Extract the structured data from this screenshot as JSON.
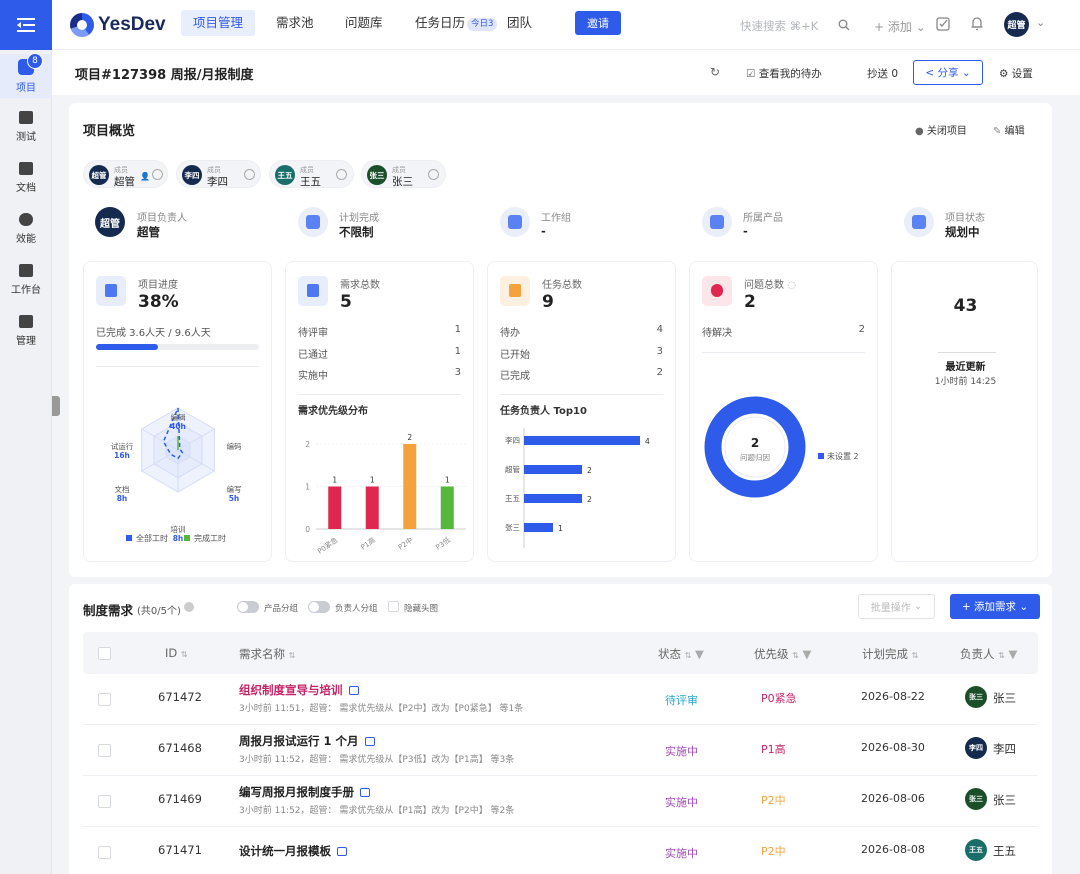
{
  "colors": {
    "accent": "#2f5bea",
    "red": "#e0274f",
    "orange": "#f5a23c",
    "green": "#55b83b",
    "pink": "#c52468",
    "purple": "#a04ab5"
  },
  "sidebar": {
    "badge": "8",
    "items": [
      {
        "label": "项目"
      },
      {
        "label": "测试"
      },
      {
        "label": "文档"
      },
      {
        "label": "效能"
      },
      {
        "label": "工作台"
      },
      {
        "label": "管理"
      }
    ]
  },
  "topnav": {
    "brand": "YesDev",
    "tabs": [
      "项目管理",
      "需求池",
      "问题库",
      "任务日历",
      "团队"
    ],
    "today_badge": "今日3",
    "invite": "邀请",
    "search_placeholder": "快速搜索 ⌘+K",
    "add": "+ 添加",
    "user_avatar": "超管"
  },
  "header": {
    "title": "项目#127398 周报/月报制度",
    "my_todo": "查看我的待办",
    "cc": "抄送 0",
    "share": "分享",
    "settings": "设置"
  },
  "overview": {
    "title": "项目概览",
    "close": "关闭项目",
    "edit": "编辑",
    "members": [
      {
        "avatar": "超管",
        "role": "成员",
        "name": "超管",
        "color": "#142a4f"
      },
      {
        "avatar": "李四",
        "role": "成员",
        "name": "李四",
        "color": "#142a4f"
      },
      {
        "avatar": "王五",
        "role": "成员",
        "name": "王五",
        "color": "#1a6e6a"
      },
      {
        "avatar": "张三",
        "role": "成员",
        "name": "张三",
        "color": "#1a4f2a"
      }
    ],
    "info": [
      {
        "label": "项目负责人",
        "value": "超管",
        "avatar": "超管"
      },
      {
        "label": "计划完成",
        "value": "不限制"
      },
      {
        "label": "工作组",
        "value": "-"
      },
      {
        "label": "所属产品",
        "value": "-"
      },
      {
        "label": "项目状态",
        "value": "规划中"
      }
    ],
    "progress": {
      "label": "项目进度",
      "value": "38%",
      "fraction": 0.38,
      "detail": "已完成 3.6人天 / 9.6人天"
    },
    "radar": {
      "axes": [
        {
          "name": "编辑",
          "value": "40h"
        },
        {
          "name": "编码",
          "value": ""
        },
        {
          "name": "编写",
          "value": "5h"
        },
        {
          "name": "培训",
          "value": "8h"
        },
        {
          "name": "文档",
          "value": "8h"
        },
        {
          "name": "试运行",
          "value": "16h"
        }
      ],
      "legend": [
        "全部工时",
        "完成工时"
      ]
    },
    "requirements": {
      "label": "需求总数",
      "value": "5",
      "rows": [
        {
          "label": "待评审",
          "value": "1"
        },
        {
          "label": "已通过",
          "value": "1"
        },
        {
          "label": "实施中",
          "value": "3"
        }
      ],
      "chart_title": "需求优先级分布"
    },
    "tasks": {
      "label": "任务总数",
      "value": "9",
      "rows": [
        {
          "label": "待办",
          "value": "4"
        },
        {
          "label": "已开始",
          "value": "3"
        },
        {
          "label": "已完成",
          "value": "2"
        }
      ],
      "chart_title": "任务负责人 Top10"
    },
    "issues": {
      "label": "问题总数",
      "value": "2",
      "rows": [
        {
          "label": "待解决",
          "value": "2"
        }
      ],
      "donut_value": "2",
      "donut_label": "问题归因",
      "legend": "未设置 2"
    },
    "updates": {
      "value": "43",
      "label": "最近更新",
      "time": "1小时前 14:25"
    }
  },
  "chart_data": [
    {
      "type": "bar",
      "title": "需求优先级分布",
      "categories": [
        "P0紧急",
        "P1高",
        "P2中",
        "P3低"
      ],
      "values": [
        1,
        1,
        2,
        1
      ],
      "colors": [
        "#e0274f",
        "#e0274f",
        "#f5a23c",
        "#55b83b"
      ],
      "ylim": [
        0,
        2
      ],
      "yticks": [
        0,
        1,
        2
      ]
    },
    {
      "type": "bar",
      "orientation": "horizontal",
      "title": "任务负责人 Top10",
      "categories": [
        "李四",
        "超管",
        "王五",
        "张三"
      ],
      "values": [
        4,
        2,
        2,
        1
      ],
      "xlim": [
        0,
        4
      ],
      "xticks": [
        0,
        1,
        2,
        3,
        4
      ]
    },
    {
      "type": "pie",
      "categories": [
        "未设置"
      ],
      "values": [
        2
      ]
    }
  ],
  "reqs": {
    "title": "制度需求",
    "count": "(共0/5个)",
    "toggles": [
      "产品分组",
      "负责人分组",
      "隐藏头图"
    ],
    "batch": "批量操作",
    "add": "+ 添加需求",
    "columns": [
      "ID",
      "需求名称",
      "状态",
      "优先级",
      "计划完成",
      "负责人"
    ],
    "rows": [
      {
        "id": "671472",
        "name": "组织制度宣导与培训",
        "meta": "3小时前 11:51，超管： 需求优先级从【P2中】改为【P0紧急】 等1条",
        "status": "待评审",
        "status_color": "#2aa6c9",
        "priority": "P0紧急",
        "priority_color": "#c52468",
        "date": "2026-08-22",
        "owner": "张三",
        "owner_color": "#1a4f2a",
        "highlight": true
      },
      {
        "id": "671468",
        "name": "周报月报试运行 1 个月",
        "meta": "3小时前 11:52，超管： 需求优先级从【P3低】改为【P1高】 等3条",
        "status": "实施中",
        "status_color": "#a04ab5",
        "priority": "P1高",
        "priority_color": "#c52468",
        "date": "2026-08-30",
        "owner": "李四",
        "owner_color": "#142a4f",
        "highlight": false
      },
      {
        "id": "671469",
        "name": "编写周报月报制度手册",
        "meta": "3小时前 11:52，超管： 需求优先级从【P1高】改为【P2中】 等2条",
        "status": "实施中",
        "status_color": "#a04ab5",
        "priority": "P2中",
        "priority_color": "#f5a23c",
        "date": "2026-08-06",
        "owner": "张三",
        "owner_color": "#1a4f2a",
        "highlight": false
      },
      {
        "id": "671471",
        "name": "设计统一月报模板",
        "meta": "",
        "status": "实施中",
        "status_color": "#a04ab5",
        "priority": "P2中",
        "priority_color": "#f5a23c",
        "date": "2026-08-08",
        "owner": "王五",
        "owner_color": "#1a6e6a",
        "highlight": false
      }
    ]
  }
}
